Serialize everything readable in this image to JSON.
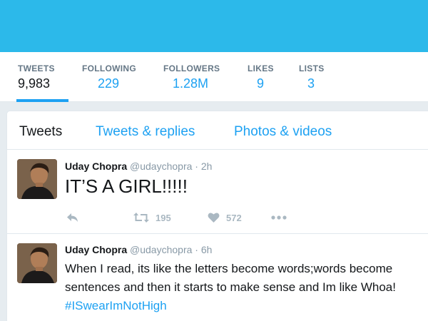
{
  "colors": {
    "banner": "#2cb9ea",
    "accent": "#1da1f2",
    "text": "#14171a",
    "muted": "#8899a6",
    "icon": "#aab8c2"
  },
  "stats": [
    {
      "label": "TWEETS",
      "value": "9,983",
      "active": true
    },
    {
      "label": "FOLLOWING",
      "value": "229"
    },
    {
      "label": "FOLLOWERS",
      "value": "1.28M"
    },
    {
      "label": "LIKES",
      "value": "9"
    },
    {
      "label": "LISTS",
      "value": "3"
    }
  ],
  "tabs": [
    {
      "label": "Tweets",
      "active": true
    },
    {
      "label": "Tweets & replies"
    },
    {
      "label": "Photos & videos"
    }
  ],
  "tweets": [
    {
      "name": "Uday Chopra",
      "handle": "@udaychopra",
      "separator": "·",
      "time": "2h",
      "text": "IT’S A GIRL!!!!!",
      "retweets": "195",
      "likes": "572",
      "icons": [
        "reply-icon",
        "retweet-icon",
        "heart-icon",
        "more-icon"
      ]
    },
    {
      "name": "Uday Chopra",
      "handle": "@udaychopra",
      "separator": "·",
      "time": "6h",
      "text": "When I read, its like the letters become words;words become sentences and then it starts to make sense and Im like Whoa!",
      "hashtag": "#ISwearImNotHigh"
    }
  ]
}
